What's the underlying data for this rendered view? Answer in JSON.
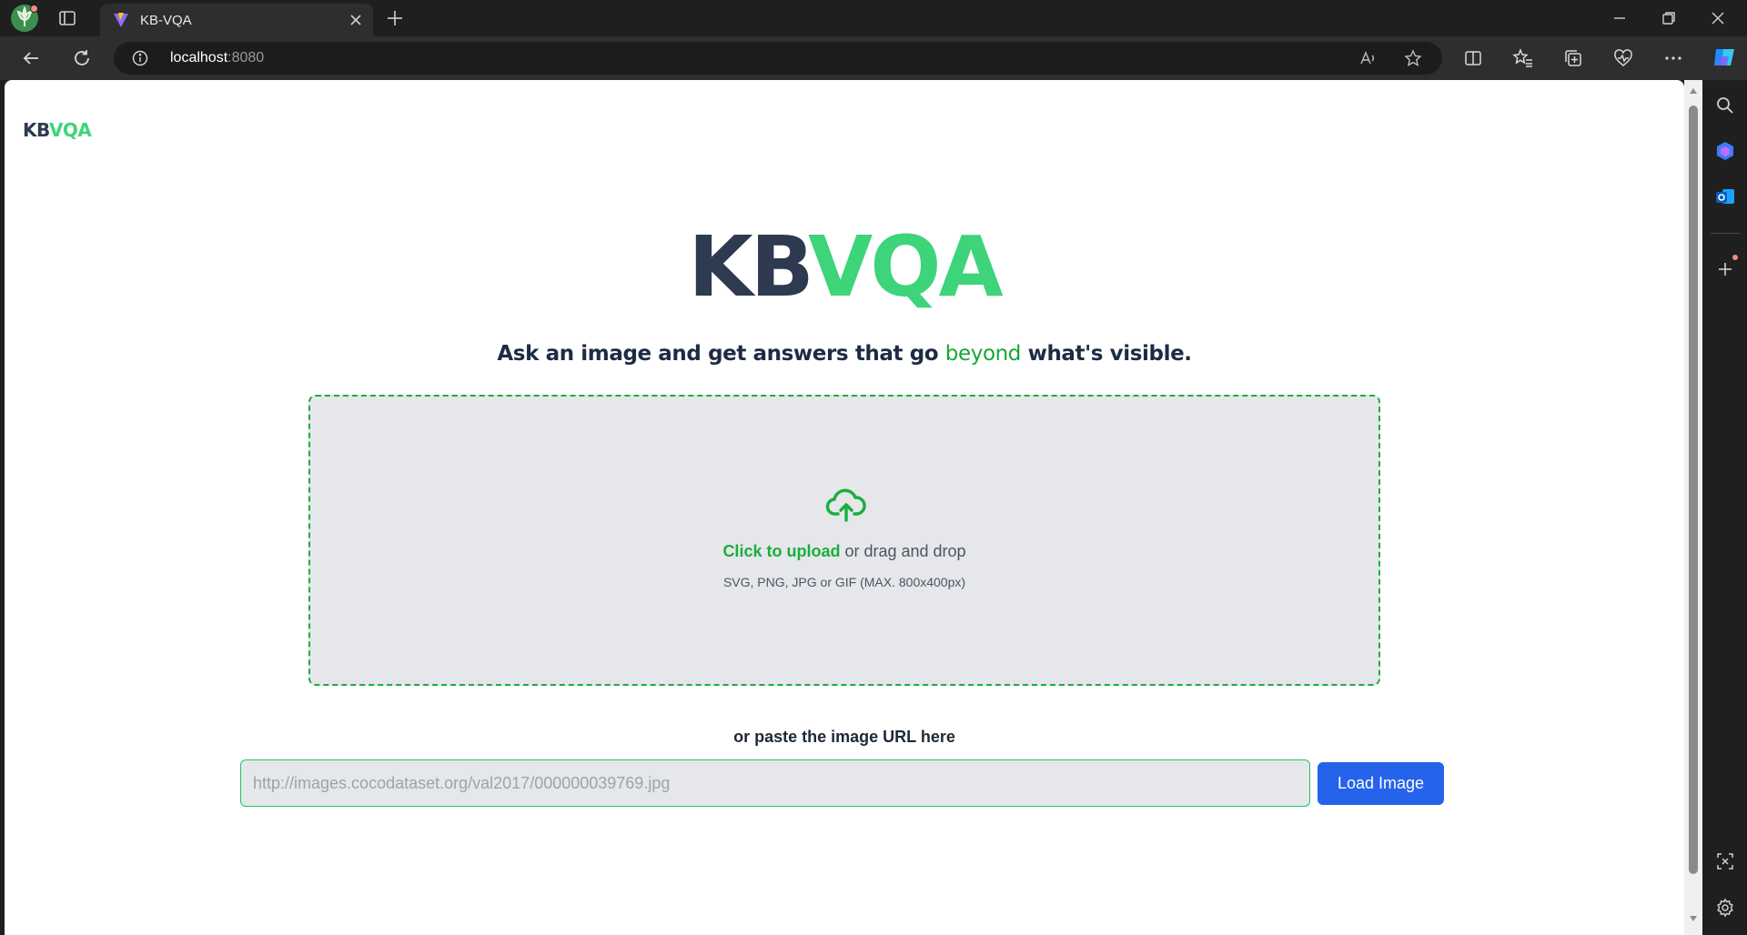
{
  "browser": {
    "tab_title": "KB-VQA",
    "url_host": "localhost",
    "url_port": ":8080",
    "profile_icon": "profile-avatar-icon",
    "accent": "#1f1f1f"
  },
  "page": {
    "brand_left": "KB",
    "brand_right": "VQA",
    "hero_left": "KB",
    "hero_right": "VQA",
    "tagline_before": "Ask an image and get answers that go ",
    "tagline_highlight": "beyond",
    "tagline_after": " what's visible.",
    "upload": {
      "cta": "Click to upload",
      "rest": " or drag and drop",
      "hint": "SVG, PNG, JPG or GIF (MAX. 800x400px)",
      "icon": "cloud-upload-icon"
    },
    "paste_label": "or paste the image URL here",
    "url_placeholder": "http://images.cocodataset.org/val2017/000000039769.jpg",
    "load_button": "Load Image"
  },
  "colors": {
    "brand_dark": "#2d3a4f",
    "brand_green": "#3dd47a",
    "cta_green": "#1aae3c",
    "button_blue": "#2563eb"
  }
}
